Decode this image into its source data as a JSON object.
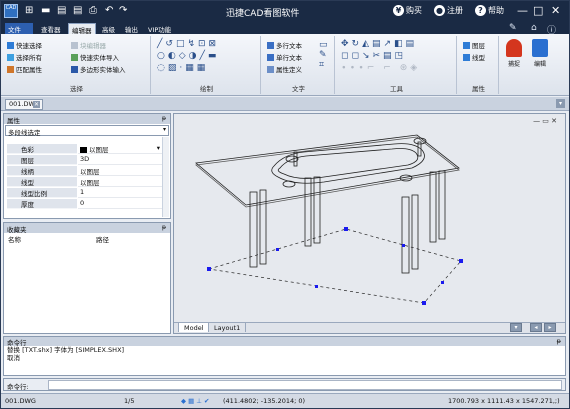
{
  "app": {
    "title": "迅捷CAD看图软件",
    "logo_label": "CAD",
    "account": {
      "buy": "购买",
      "register": "注册",
      "help": "帮助"
    }
  },
  "menu_tabs": [
    "文件",
    "查看器",
    "编辑器",
    "高级",
    "输出",
    "VIP功能"
  ],
  "active_tab": "编辑器",
  "ribbon": {
    "select_group": {
      "label": "选择",
      "items": [
        "快速选择",
        "块编辑器",
        "选择所有",
        "快速实体导入",
        "匹配属性",
        "多边形实体输入"
      ]
    },
    "draw_group": {
      "label": "绘制"
    },
    "text_group": {
      "label": "文字",
      "items": [
        "多行文本",
        "单行文本",
        "属性定义"
      ]
    },
    "tools_group": {
      "label": "工具"
    },
    "props_group": {
      "label": "属性",
      "items": [
        "图层",
        "线型"
      ]
    },
    "big_buttons": {
      "capture": "捕捉",
      "edit": "编辑"
    }
  },
  "document_tab": "001.DWG",
  "properties": {
    "title": "属性",
    "selector": "多段线选定",
    "rows": [
      {
        "key": "色彩",
        "value": "以图层"
      },
      {
        "key": "图层",
        "value": "3D"
      },
      {
        "key": "线柄",
        "value": "以图层"
      },
      {
        "key": "线型",
        "value": "以图层"
      },
      {
        "key": "线型比例",
        "value": "1"
      },
      {
        "key": "厚度",
        "value": "0"
      }
    ]
  },
  "favorites": {
    "title": "收藏夹",
    "col_name": "名称",
    "col_path": "路径"
  },
  "layout_tabs": [
    "Model",
    "Layout1"
  ],
  "command": {
    "title": "命令行",
    "lines": [
      "替换 [TXT.shx] 字体为 [SIMPLEX.SHX]",
      "取消"
    ],
    "prompt": "命令行:"
  },
  "status": {
    "file": "001.DWG",
    "page": "1/5",
    "coords": "(411.4802; -135.2014; 0)",
    "size": "1700.793 x 1111.43 x 1547.271,;)"
  },
  "colors": {
    "titlebar": "#1a2a44",
    "accent": "#2d5fb0",
    "drawing_line": "#222222",
    "grip": "#1a1aee"
  }
}
